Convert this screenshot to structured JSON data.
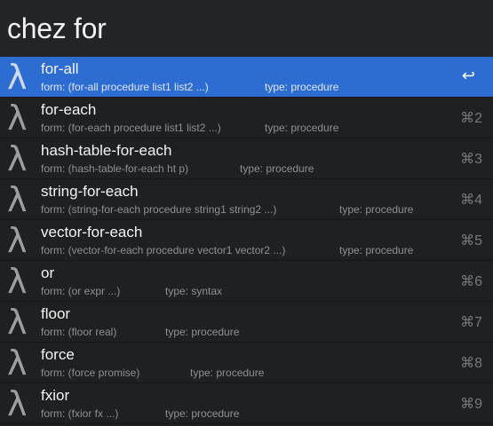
{
  "search": {
    "query": "chez for"
  },
  "results": [
    {
      "title": "for-all",
      "form": "form: (for-all procedure list1 list2 ...)",
      "type": "type: procedure",
      "shortcut": "↩"
    },
    {
      "title": "for-each",
      "form": "form: (for-each procedure list1 list2 ...)",
      "type": "type: procedure",
      "shortcut": "⌘2"
    },
    {
      "title": "hash-table-for-each",
      "form": "form: (hash-table-for-each ht p)",
      "type": "type: procedure",
      "shortcut": "⌘3"
    },
    {
      "title": "string-for-each",
      "form": "form: (string-for-each procedure string1 string2 ...)",
      "type": "type: procedure",
      "shortcut": "⌘4"
    },
    {
      "title": "vector-for-each",
      "form": "form: (vector-for-each procedure vector1 vector2 ...)",
      "type": "type: procedure",
      "shortcut": "⌘5"
    },
    {
      "title": "or",
      "form": "form: (or expr ...)",
      "type": "type: syntax",
      "shortcut": "⌘6"
    },
    {
      "title": "floor",
      "form": "form: (floor real)",
      "type": "type: procedure",
      "shortcut": "⌘7"
    },
    {
      "title": "force",
      "form": "form: (force promise)",
      "type": "type: procedure",
      "shortcut": "⌘8"
    },
    {
      "title": "fxior",
      "form": "form: (fxior fx ...)",
      "type": "type: procedure",
      "shortcut": "⌘9"
    }
  ],
  "icons": {
    "result_icon": "lambda-icon",
    "result_icon_glyph": "λ"
  },
  "colors": {
    "selected_row": "#2d6dd2",
    "background": "#1f2022"
  }
}
